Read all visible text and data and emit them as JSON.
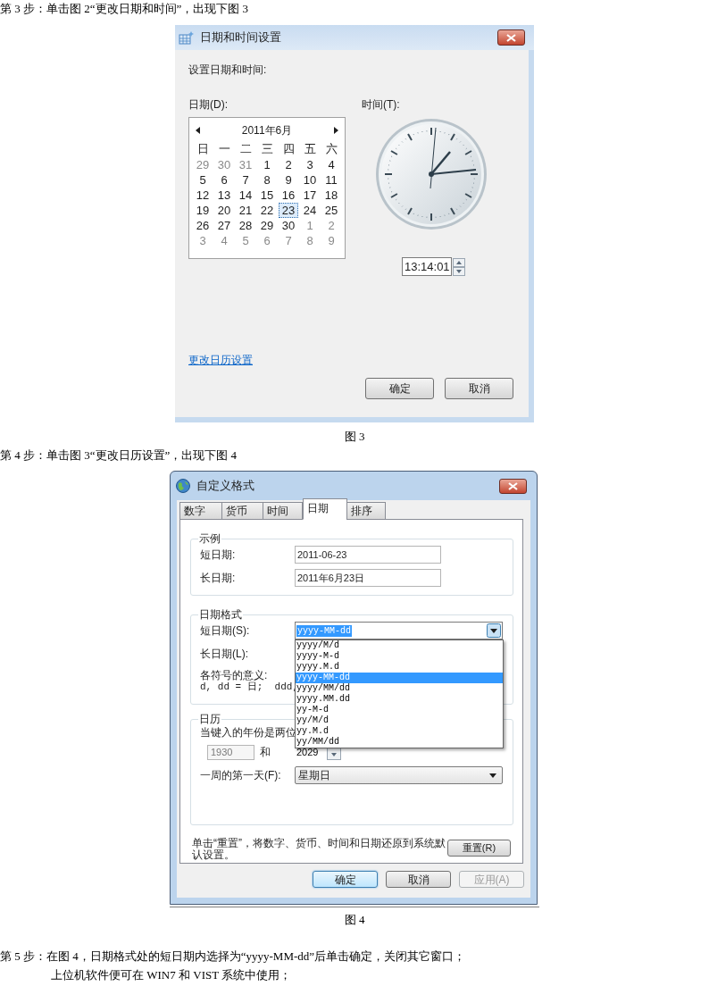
{
  "step3": "第 3 步：单击图 2“更改日期和时间”，出现下图 3",
  "figure3": {
    "window": {
      "title": "日期和时间设置",
      "heading": "设置日期和时间:",
      "date_label": "日期(D):",
      "time_label": "时间(T):",
      "calendar": {
        "month": "2011年6月",
        "weekdays": [
          "日",
          "一",
          "二",
          "三",
          "四",
          "五",
          "六"
        ],
        "weeks": [
          [
            {
              "d": "29",
              "other_month": true,
              "selected": false
            },
            {
              "d": "30",
              "other_month": true,
              "selected": false
            },
            {
              "d": "31",
              "other_month": true,
              "selected": false
            },
            {
              "d": "1",
              "other_month": false,
              "selected": false
            },
            {
              "d": "2",
              "other_month": false,
              "selected": false
            },
            {
              "d": "3",
              "other_month": false,
              "selected": false
            },
            {
              "d": "4",
              "other_month": false,
              "selected": false
            }
          ],
          [
            {
              "d": "5",
              "other_month": false,
              "selected": false
            },
            {
              "d": "6",
              "other_month": false,
              "selected": false
            },
            {
              "d": "7",
              "other_month": false,
              "selected": false
            },
            {
              "d": "8",
              "other_month": false,
              "selected": false
            },
            {
              "d": "9",
              "other_month": false,
              "selected": false
            },
            {
              "d": "10",
              "other_month": false,
              "selected": false
            },
            {
              "d": "11",
              "other_month": false,
              "selected": false
            }
          ],
          [
            {
              "d": "12",
              "other_month": false,
              "selected": false
            },
            {
              "d": "13",
              "other_month": false,
              "selected": false
            },
            {
              "d": "14",
              "other_month": false,
              "selected": false
            },
            {
              "d": "15",
              "other_month": false,
              "selected": false
            },
            {
              "d": "16",
              "other_month": false,
              "selected": false
            },
            {
              "d": "17",
              "other_month": false,
              "selected": false
            },
            {
              "d": "18",
              "other_month": false,
              "selected": false
            }
          ],
          [
            {
              "d": "19",
              "other_month": false,
              "selected": false
            },
            {
              "d": "20",
              "other_month": false,
              "selected": false
            },
            {
              "d": "21",
              "other_month": false,
              "selected": false
            },
            {
              "d": "22",
              "other_month": false,
              "selected": false
            },
            {
              "d": "23",
              "other_month": false,
              "selected": true
            },
            {
              "d": "24",
              "other_month": false,
              "selected": false
            },
            {
              "d": "25",
              "other_month": false,
              "selected": false
            }
          ],
          [
            {
              "d": "26",
              "other_month": false,
              "selected": false
            },
            {
              "d": "27",
              "other_month": false,
              "selected": false
            },
            {
              "d": "28",
              "other_month": false,
              "selected": false
            },
            {
              "d": "29",
              "other_month": false,
              "selected": false
            },
            {
              "d": "30",
              "other_month": false,
              "selected": false
            },
            {
              "d": "1",
              "other_month": true,
              "selected": false
            },
            {
              "d": "2",
              "other_month": true,
              "selected": false
            }
          ],
          [
            {
              "d": "3",
              "other_month": true,
              "selected": false
            },
            {
              "d": "4",
              "other_month": true,
              "selected": false
            },
            {
              "d": "5",
              "other_month": true,
              "selected": false
            },
            {
              "d": "6",
              "other_month": true,
              "selected": false
            },
            {
              "d": "7",
              "other_month": true,
              "selected": false
            },
            {
              "d": "8",
              "other_month": true,
              "selected": false
            },
            {
              "d": "9",
              "other_month": true,
              "selected": false
            }
          ]
        ]
      },
      "time_value": "13:14:01",
      "link": "更改日历设置",
      "buttons": [
        "确定",
        "取消"
      ]
    },
    "caption": "图 3"
  },
  "step4": "第 4 步：单击图 3“更改日历设置”，出现下图 4",
  "figure4": {
    "window": {
      "title": "自定义格式",
      "tabs": [
        {
          "label": "数字",
          "selected": false
        },
        {
          "label": "货币",
          "selected": false
        },
        {
          "label": "时间",
          "selected": false
        },
        {
          "label": "日期",
          "selected": true
        },
        {
          "label": "排序",
          "selected": false
        }
      ],
      "example": {
        "title": "示例",
        "rows": [
          {
            "label": "短日期:",
            "value": "2011-06-23"
          },
          {
            "label": "长日期:",
            "value": "2011年6月23日"
          }
        ]
      },
      "date_format": {
        "title": "日期格式",
        "short_label": "短日期(S):",
        "short_value": "yyyy-MM-dd",
        "text_selected": true,
        "long_label": "长日期(L):",
        "meaning_label": "各符号的意义:",
        "meaning_text": "d, dd = 日;  ddd,",
        "options": [
          {
            "text": "yyyy/M/d",
            "selected": false
          },
          {
            "text": "yyyy-M-d",
            "selected": false
          },
          {
            "text": "yyyy.M.d",
            "selected": false
          },
          {
            "text": "yyyy-MM-dd",
            "selected": true
          },
          {
            "text": "yyyy/MM/dd",
            "selected": false
          },
          {
            "text": "yyyy.MM.dd",
            "selected": false
          },
          {
            "text": "yy-M-d",
            "selected": false
          },
          {
            "text": "yy/M/d",
            "selected": false
          },
          {
            "text": "yy.M.d",
            "selected": false
          },
          {
            "text": "yy/MM/dd",
            "selected": false
          }
        ]
      },
      "calendar": {
        "title": "日历",
        "note": "当键入的年份是两位",
        "from": {
          "value": "1930",
          "disabled": true
        },
        "joiner": "和",
        "to": {
          "value": "2029",
          "disabled": false
        },
        "first_day_label": "一周的第一天(F):",
        "first_day_value": "星期日"
      },
      "reset_note": "单击“重置”，将数字、货币、时间和日期还原到系统默认设置。",
      "reset_button": "重置(R)",
      "buttons": [
        {
          "label": "确定",
          "default": true,
          "disabled": false
        },
        {
          "label": "取消",
          "default": false,
          "disabled": false
        },
        {
          "label": "应用(A)",
          "default": false,
          "disabled": true
        }
      ]
    },
    "caption": "图 4"
  },
  "step5": {
    "lines": [
      "第 5 步：在图 4，日期格式处的短日期内选择为“yyyy-MM-dd”后单击确定，关闭其它窗口；",
      "上位机软件便可在 WIN7 和 VIST 系统中使用；"
    ]
  }
}
